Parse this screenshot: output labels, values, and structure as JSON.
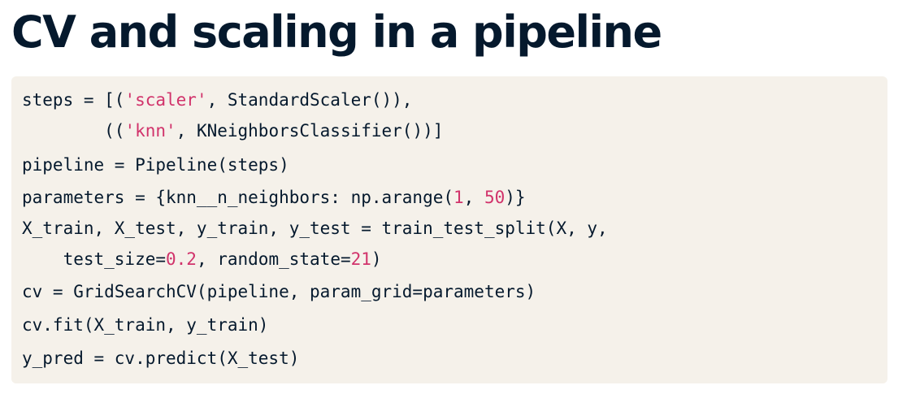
{
  "slide": {
    "title": "CV and scaling in a pipeline"
  },
  "code": {
    "lines": [
      [
        {
          "t": "steps = [(",
          "c": "plain"
        },
        {
          "t": "'scaler'",
          "c": "str"
        },
        {
          "t": ", StandardScaler()),",
          "c": "plain"
        }
      ],
      [
        {
          "t": "        ((",
          "c": "plain"
        },
        {
          "t": "'knn'",
          "c": "str"
        },
        {
          "t": ", KNeighborsClassifier())]",
          "c": "plain"
        }
      ],
      [
        {
          "t": "pipeline = Pipeline(steps)",
          "c": "plain"
        }
      ],
      [
        {
          "t": "parameters = {knn__n_neighbors: np.arange(",
          "c": "plain"
        },
        {
          "t": "1",
          "c": "num"
        },
        {
          "t": ", ",
          "c": "plain"
        },
        {
          "t": "50",
          "c": "num"
        },
        {
          "t": ")}",
          "c": "plain"
        }
      ],
      [
        {
          "t": "X_train, X_test, y_train, y_test = train_test_split(X, y,",
          "c": "plain"
        }
      ],
      [
        {
          "t": "    test_size=",
          "c": "plain"
        },
        {
          "t": "0.2",
          "c": "num"
        },
        {
          "t": ", random_state=",
          "c": "plain"
        },
        {
          "t": "21",
          "c": "num"
        },
        {
          "t": ")",
          "c": "plain"
        }
      ],
      [
        {
          "t": "cv = GridSearchCV(pipeline, param_grid=parameters)",
          "c": "plain"
        }
      ],
      [
        {
          "t": "cv.fit(X_train, y_train)",
          "c": "plain"
        }
      ],
      [
        {
          "t": "y_pred = cv.predict(X_test)",
          "c": "plain"
        }
      ]
    ]
  }
}
